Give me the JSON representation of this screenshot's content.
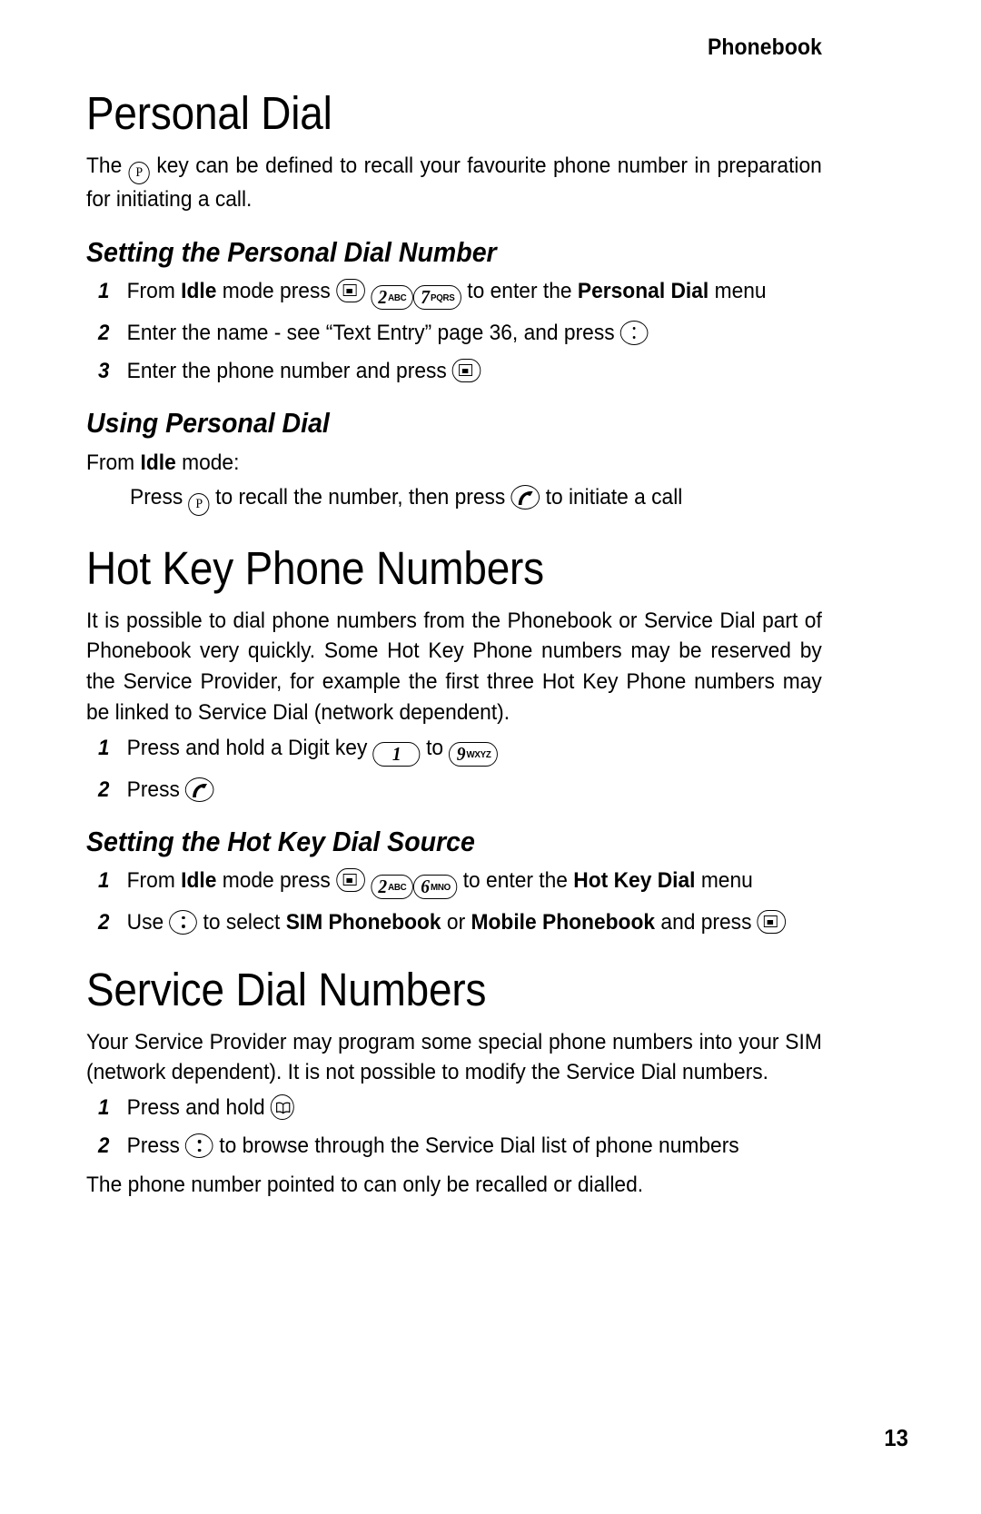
{
  "header": {
    "running_head": "Phonebook"
  },
  "page_number": "13",
  "sections": [
    {
      "id": "personal-dial",
      "title": "Personal Dial",
      "intro": {
        "before": "The",
        "after": "key can be defined to recall your favourite phone number in preparation for initiating a call."
      },
      "subsections": [
        {
          "id": "setting-personal-dial-number",
          "title": "Setting the Personal Dial Number",
          "steps": [
            {
              "num": "1",
              "parts": [
                "From ",
                "Idle",
                " mode press ",
                "[select] [2ABC] [7PQRS]",
                " to enter the ",
                "Personal Dial",
                " menu"
              ],
              "text_a": "From ",
              "bold_a": "Idle",
              "text_b": " mode press ",
              "text_c": " to enter the ",
              "bold_b": "Personal Dial",
              "text_d": " menu"
            },
            {
              "num": "2",
              "text_a": "Enter the name - see “Text Entry” page 36, and press "
            },
            {
              "num": "3",
              "text_a": "Enter the phone number and press "
            }
          ]
        },
        {
          "id": "using-personal-dial",
          "title": "Using Personal Dial",
          "lead_a": "From ",
          "lead_bold": "Idle",
          "lead_b": " mode:",
          "indented": {
            "text_a": "Press ",
            "text_b": " to recall the number, then press ",
            "text_c": " to initiate a call"
          }
        }
      ]
    },
    {
      "id": "hot-key-phone-numbers",
      "title": "Hot Key Phone Numbers",
      "paragraph": "It is possible to dial phone numbers from the Phonebook or Service Dial part of Phonebook very quickly. Some Hot Key Phone numbers may be reserved by the Service Provider, for example the first three Hot Key Phone numbers may be linked to Service Dial (network dependent).",
      "steps": [
        {
          "num": "1",
          "text_a": "Press and hold a Digit key ",
          "text_b": " to "
        },
        {
          "num": "2",
          "text_a": "Press "
        }
      ],
      "subsections": [
        {
          "id": "setting-hot-key-dial-source",
          "title": "Setting the Hot Key Dial Source",
          "steps": [
            {
              "num": "1",
              "text_a": "From ",
              "bold_a": "Idle",
              "text_b": " mode press ",
              "text_c": " to enter the ",
              "bold_b": "Hot Key Dial",
              "text_d": " menu"
            },
            {
              "num": "2",
              "text_a": "Use ",
              "text_b": " to select ",
              "bold_a": "SIM Phonebook",
              "text_c": " or ",
              "bold_b": "Mobile Phonebook",
              "text_d": " and press "
            }
          ]
        }
      ]
    },
    {
      "id": "service-dial-numbers",
      "title": "Service Dial Numbers",
      "paragraph": "Your Service Provider may program some special phone numbers into your SIM (network dependent). It is not possible to modify the Service Dial numbers.",
      "steps": [
        {
          "num": "1",
          "text_a": "Press and hold "
        },
        {
          "num": "2",
          "text_a": "Press ",
          "text_b": " to browse through the Service Dial list of phone numbers"
        }
      ],
      "closing": "The phone number pointed to can only be recalled or dialled."
    }
  ],
  "keys": {
    "p_key": "P",
    "digit_2": {
      "digit": "2",
      "letters": "ABC"
    },
    "digit_6": {
      "digit": "6",
      "letters": "MNO"
    },
    "digit_7": {
      "digit": "7",
      "letters": "PQRS"
    },
    "digit_9": {
      "digit": "9",
      "letters": "WXYZ"
    },
    "digit_1": {
      "digit": "1",
      "letters": ""
    }
  },
  "colors": {
    "text": "#000000",
    "background": "#ffffff"
  }
}
